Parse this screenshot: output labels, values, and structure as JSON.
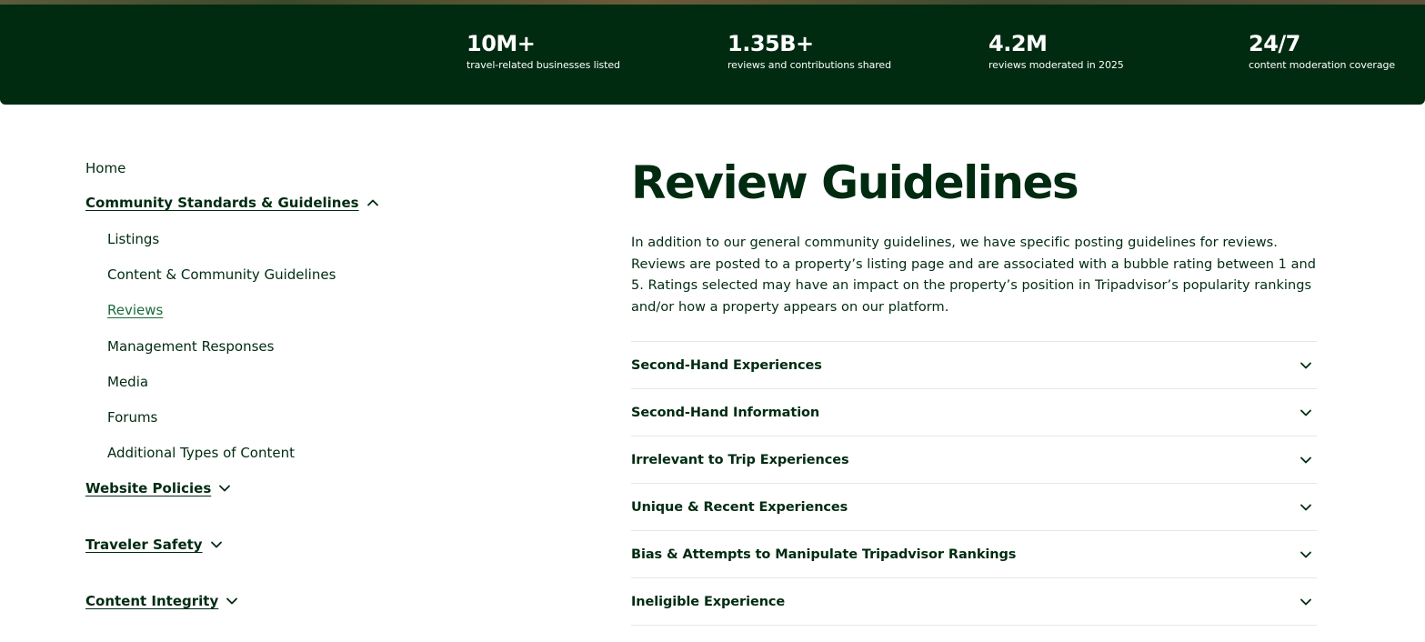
{
  "stats": [
    {
      "value": "10M+",
      "label": "travel-related businesses listed"
    },
    {
      "value": "1.35B+",
      "label": "reviews and contributions shared"
    },
    {
      "value": "4.2M",
      "label": "reviews moderated in 2025"
    },
    {
      "value": "24/7",
      "label": "content moderation coverage"
    }
  ],
  "sidebar": {
    "home": "Home",
    "community": {
      "label": "Community Standards & Guidelines",
      "expanded": true,
      "items": [
        "Listings",
        "Content & Community Guidelines",
        "Reviews",
        "Management Responses",
        "Media",
        "Forums",
        "Additional Types of Content"
      ],
      "active_item": "Reviews"
    },
    "website_policies": "Website Policies",
    "traveler_safety": "Traveler Safety",
    "content_integrity": "Content Integrity"
  },
  "main": {
    "title": "Review Guidelines",
    "intro": "In addition to our general community guidelines, we have specific posting guidelines for reviews.  Reviews are posted to a property’s listing page and are associated with a bubble rating between 1 and 5.  Ratings selected may have an impact on the property’s position in Tripadvisor’s popularity rankings and/or how a property appears on our platform.",
    "accordion": [
      "Second-Hand Experiences",
      "Second-Hand Information",
      "Irrelevant to Trip Experiences",
      "Unique & Recent Experiences",
      "Bias & Attempts to Manipulate Tripadvisor Rankings",
      "Ineligible Experience"
    ]
  },
  "colors": {
    "brand_dark_green": "#002b11",
    "active_link": "#1c6b3a",
    "divider": "#e4e8e5"
  }
}
